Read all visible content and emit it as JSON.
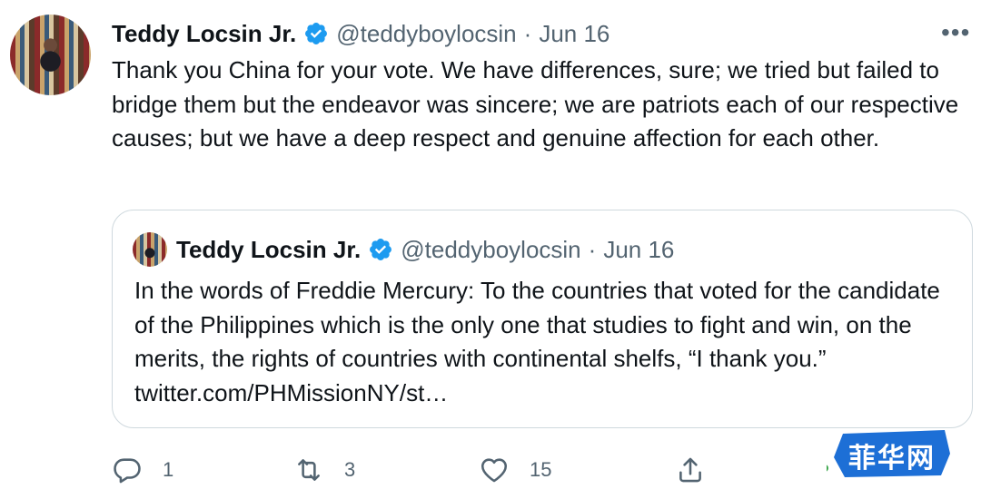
{
  "tweet": {
    "author_name": "Teddy Locsin Jr.",
    "handle": "@teddyboylocsin",
    "separator": "·",
    "date": "Jun 16",
    "more_label": "•••",
    "text": "Thank you China for your vote. We have differences, sure; we tried but failed to bridge them but the endeavor was sincere; we are patriots each of our respective causes; but we have a deep respect and genuine affection for each other."
  },
  "quoted_tweet": {
    "author_name": "Teddy Locsin Jr.",
    "handle": "@teddyboylocsin",
    "separator": "·",
    "date": "Jun 16",
    "text": "In the words of Freddie Mercury: To the countries that voted for the candidate of the Philippines which is the only one that studies to fight and win, on the merits, the rights of countries with continental shelfs, “I thank you.” twitter.com/PHMissionNY/st…"
  },
  "actions": {
    "reply_count": "1",
    "retweet_count": "3",
    "like_count": "15",
    "icons": [
      "reply-icon",
      "retweet-icon",
      "like-icon",
      "share-icon"
    ]
  },
  "watermark": {
    "text": "菲华网",
    "color": "#1d6fd6"
  },
  "colors": {
    "text": "#0f1419",
    "secondary": "#536471",
    "verified": "#1d9bf0",
    "border": "#cfd9de"
  }
}
